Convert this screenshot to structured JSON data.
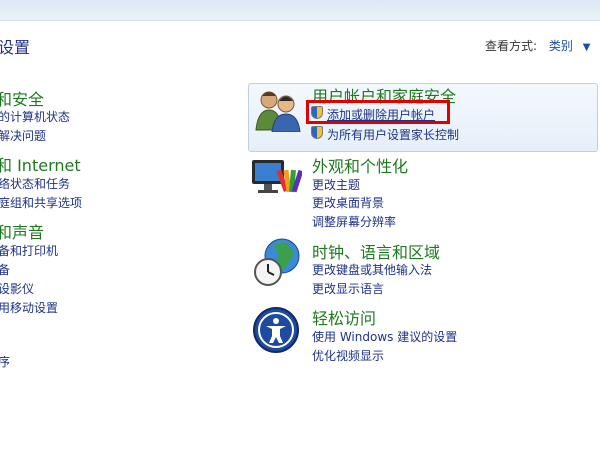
{
  "header": {
    "title_fragment": "设置",
    "view_by_label": "查看方式:",
    "view_by_value": "类别"
  },
  "left_categories": [
    {
      "title": "和安全",
      "links": [
        "的计算机状态",
        "解决问题"
      ]
    },
    {
      "title": "和 Internet",
      "links": [
        "络状态和任务",
        "庭组和共享选项"
      ]
    },
    {
      "title": "和声音",
      "links": [
        "备和打印机",
        "备",
        "设影仪",
        "用移动设置"
      ]
    }
  ],
  "left_extra_link": "序",
  "right_categories": [
    {
      "title": "用户帐户和家庭安全",
      "links": [
        "添加或删除用户帐户",
        "为所有用户设置家长控制"
      ],
      "icon": "users-icon"
    },
    {
      "title": "外观和个性化",
      "links": [
        "更改主题",
        "更改桌面背景",
        "调整屏幕分辨率"
      ],
      "icon": "monitor-palette-icon"
    },
    {
      "title": "时钟、语言和区域",
      "links": [
        "更改键盘或其他输入法",
        "更改显示语言"
      ],
      "icon": "globe-clock-icon"
    },
    {
      "title": "轻松访问",
      "links": [
        "使用 Windows 建议的设置",
        "优化视频显示"
      ],
      "icon": "accessibility-icon"
    }
  ],
  "colors": {
    "category_title": "#1e7a1e",
    "link": "#1e3287",
    "highlight": "#e00000"
  }
}
